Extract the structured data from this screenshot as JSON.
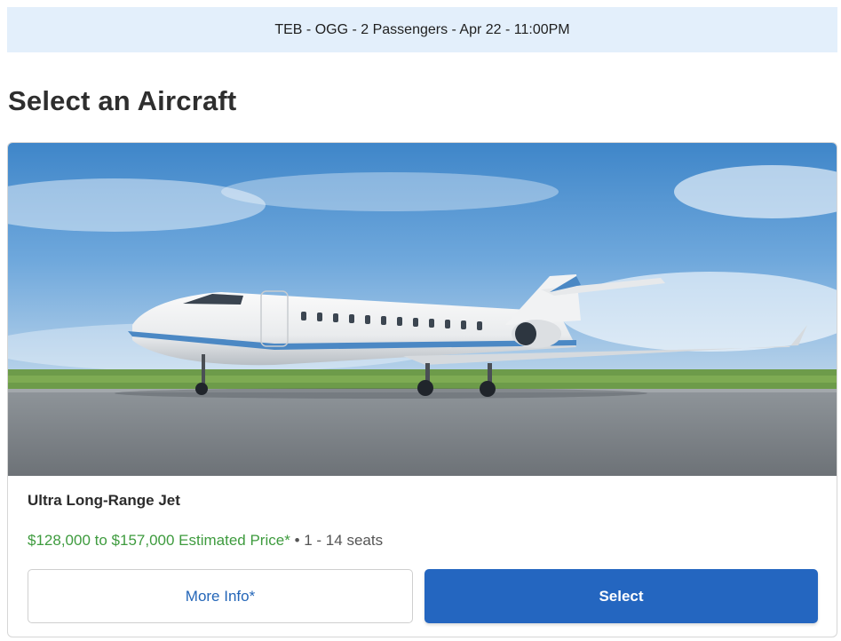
{
  "trip_summary": "TEB - OGG - 2 Passengers - Apr 22 - 11:00PM",
  "page_title": "Select an Aircraft",
  "aircraft": {
    "name": "Ultra Long-Range Jet",
    "price": "$128,000 to $157,000 Estimated Price*",
    "separator": "•",
    "seats": "1 - 14 seats",
    "more_info_label": "More Info*",
    "select_label": "Select"
  },
  "colors": {
    "banner_bg": "#e3effb",
    "price_green": "#3e9b3e",
    "primary_blue": "#2466c0"
  }
}
